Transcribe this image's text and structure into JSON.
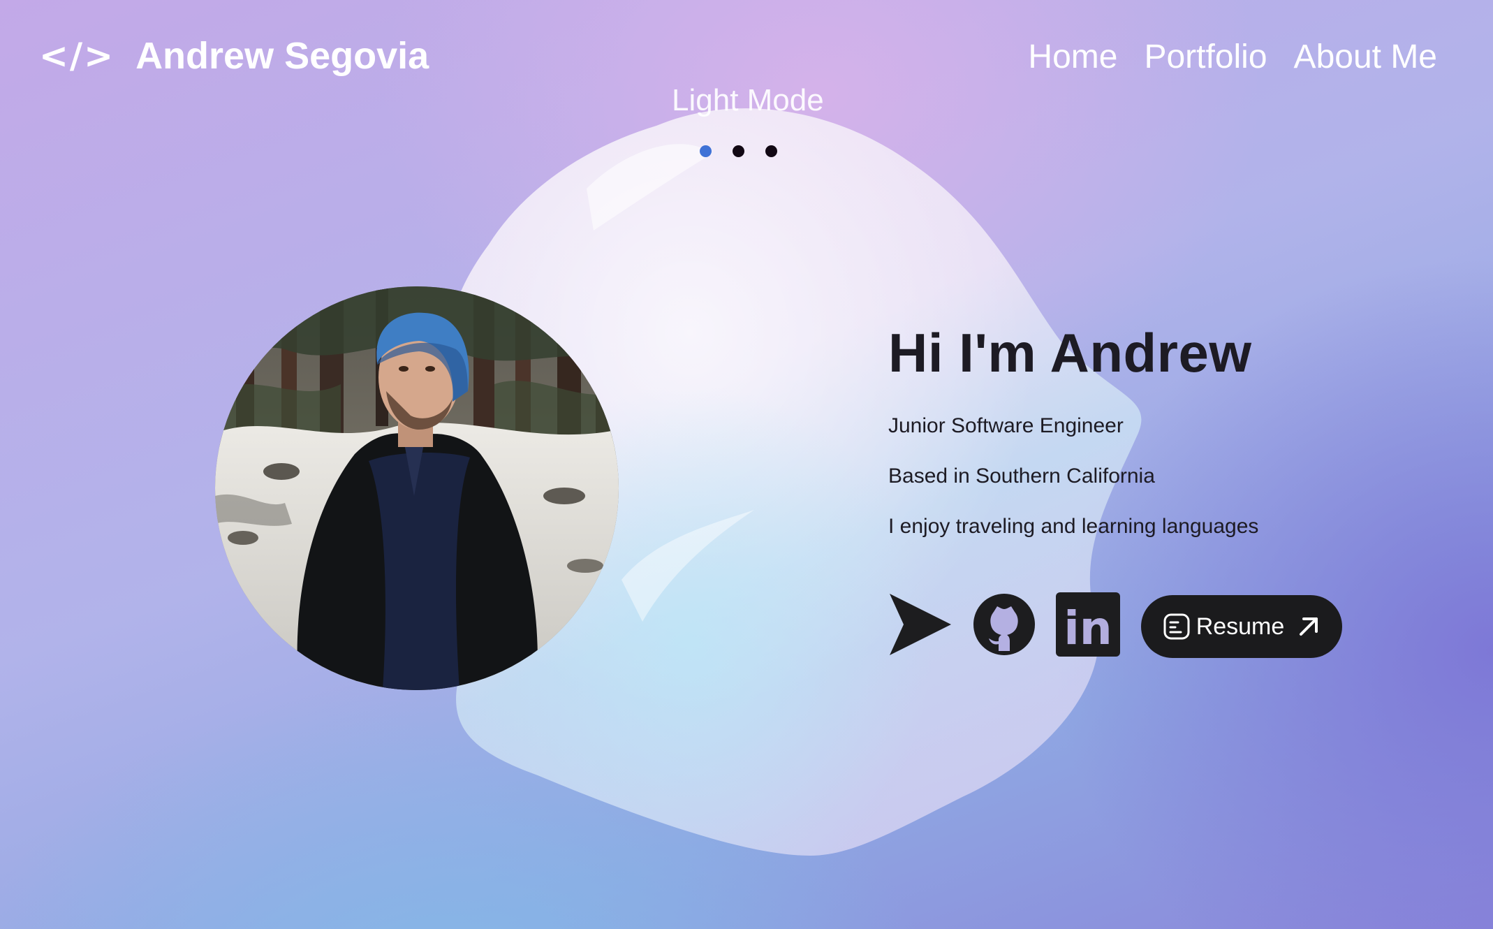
{
  "header": {
    "logo_icon": "</>",
    "name": "Andrew Segovia",
    "nav": [
      "Home",
      "Portfolio",
      "About Me"
    ]
  },
  "theme": {
    "toggle_label": "Light Mode",
    "options": [
      {
        "color": "#3f72d6",
        "active": true
      },
      {
        "color": "#120814",
        "active": false
      },
      {
        "color": "#120814",
        "active": false
      }
    ]
  },
  "intro": {
    "greeting": "Hi I'm Andrew",
    "lines": [
      "Junior Software Engineer",
      "Based in Southern California",
      "I enjoy traveling and learning languages"
    ]
  },
  "socials": {
    "icons": [
      "send-icon",
      "github-icon",
      "linkedin-icon"
    ],
    "linkedin_text": "in",
    "resume_label": "Resume"
  },
  "colors": {
    "text_dark": "#1d1b24",
    "button_bg": "#1b1b1d",
    "active_dot": "#3f72d6"
  }
}
